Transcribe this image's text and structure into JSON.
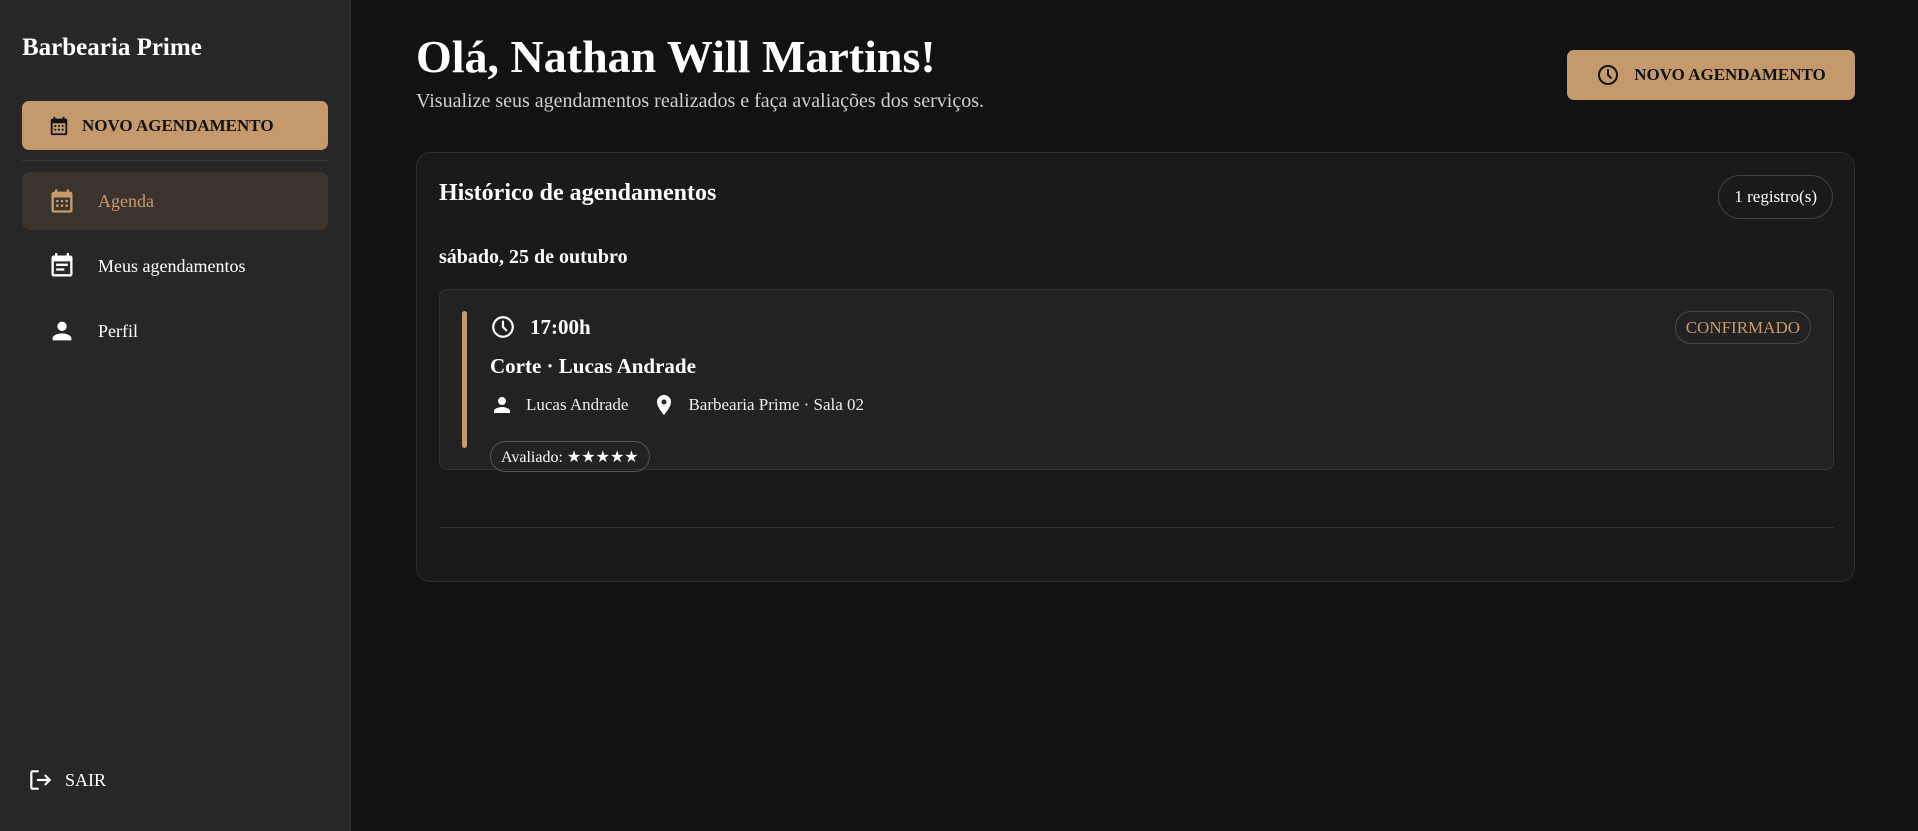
{
  "sidebar": {
    "brand": "Barbearia Prime",
    "cta_label": "NOVO AGENDAMENTO",
    "items": [
      {
        "label": "Agenda",
        "icon": "calendar-icon",
        "active": true
      },
      {
        "label": "Meus agendamentos",
        "icon": "event-note-icon",
        "active": false
      },
      {
        "label": "Perfil",
        "icon": "person-icon",
        "active": false
      }
    ],
    "logout_label": "SAIR"
  },
  "header": {
    "greeting": "Olá, Nathan Will Martins!",
    "subtitle": "Visualize seus agendamentos realizados e faça avaliações dos serviços.",
    "cta_label": "NOVO AGENDAMENTO"
  },
  "history": {
    "title": "Histórico de agendamentos",
    "count": "1 registro(s)",
    "groups": [
      {
        "date": "sábado, 25 de outubro",
        "appointments": [
          {
            "time": "17:00h",
            "status": "CONFIRMADO",
            "service": "Corte · Lucas Andrade",
            "barber": "Lucas Andrade",
            "location": "Barbearia Prime · Sala 02",
            "rating_label": "Avaliado: ★★★★★"
          }
        ]
      }
    ]
  },
  "colors": {
    "accent": "#c49a6c",
    "background": "#121212",
    "sidebar": "#272727",
    "card": "#1a1a1a"
  }
}
